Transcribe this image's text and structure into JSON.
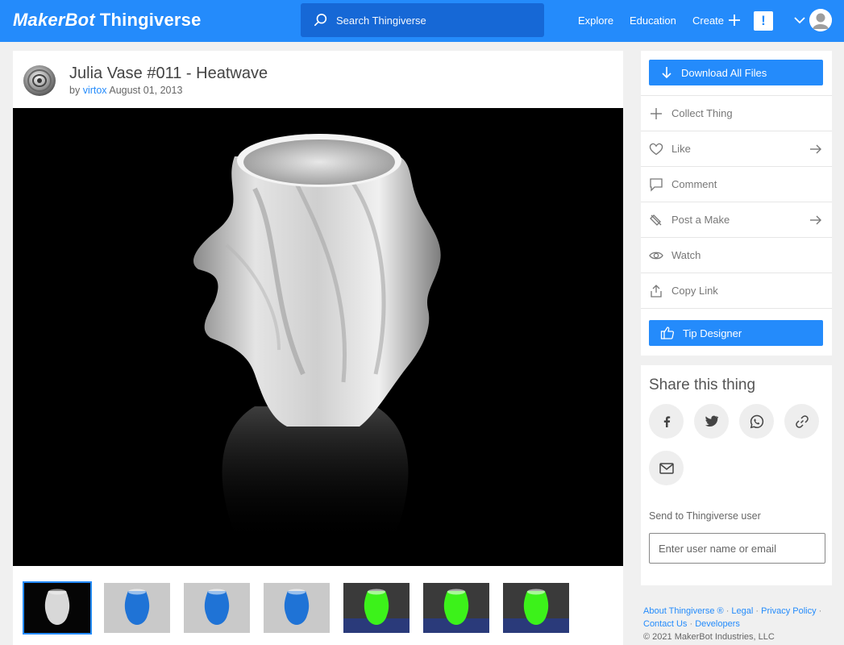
{
  "header": {
    "logo_brand": "MakerBot",
    "logo_product": "Thingiverse",
    "search_placeholder": "Search Thingiverse",
    "nav": {
      "explore": "Explore",
      "education": "Education",
      "create": "Create"
    },
    "alert_glyph": "!"
  },
  "thing": {
    "title": "Julia Vase #011 - Heatwave",
    "by_prefix": "by",
    "author": "virtox",
    "date": "August 01, 2013",
    "thumbnails": [
      {
        "name": "render-white",
        "tone": "dark"
      },
      {
        "name": "blue-vase-1",
        "tone": "blue"
      },
      {
        "name": "blue-vase-2",
        "tone": "blue"
      },
      {
        "name": "blue-vase-3",
        "tone": "blue"
      },
      {
        "name": "green-vase-top",
        "tone": "green"
      },
      {
        "name": "green-vase-side",
        "tone": "green"
      },
      {
        "name": "green-vase-front",
        "tone": "green"
      }
    ]
  },
  "actions": {
    "download": "Download All Files",
    "collect": "Collect Thing",
    "like": "Like",
    "comment": "Comment",
    "post_make": "Post a Make",
    "watch": "Watch",
    "copy_link": "Copy Link",
    "tip": "Tip Designer"
  },
  "share": {
    "title": "Share this thing",
    "icons": [
      "facebook-icon",
      "twitter-icon",
      "whatsapp-icon",
      "link-icon",
      "mail-icon"
    ],
    "send_label": "Send to Thingiverse user",
    "input_placeholder": "Enter user name or email"
  },
  "footer": {
    "about": "About Thingiverse ®",
    "legal": "Legal",
    "privacy": "Privacy Policy",
    "contact": "Contact Us",
    "developers": "Developers",
    "copyright": "© 2021 MakerBot Industries, LLC"
  },
  "colors": {
    "brand_blue": "#248bfb",
    "search_bg": "#1668d6",
    "page_bg": "#f0f0f0"
  }
}
